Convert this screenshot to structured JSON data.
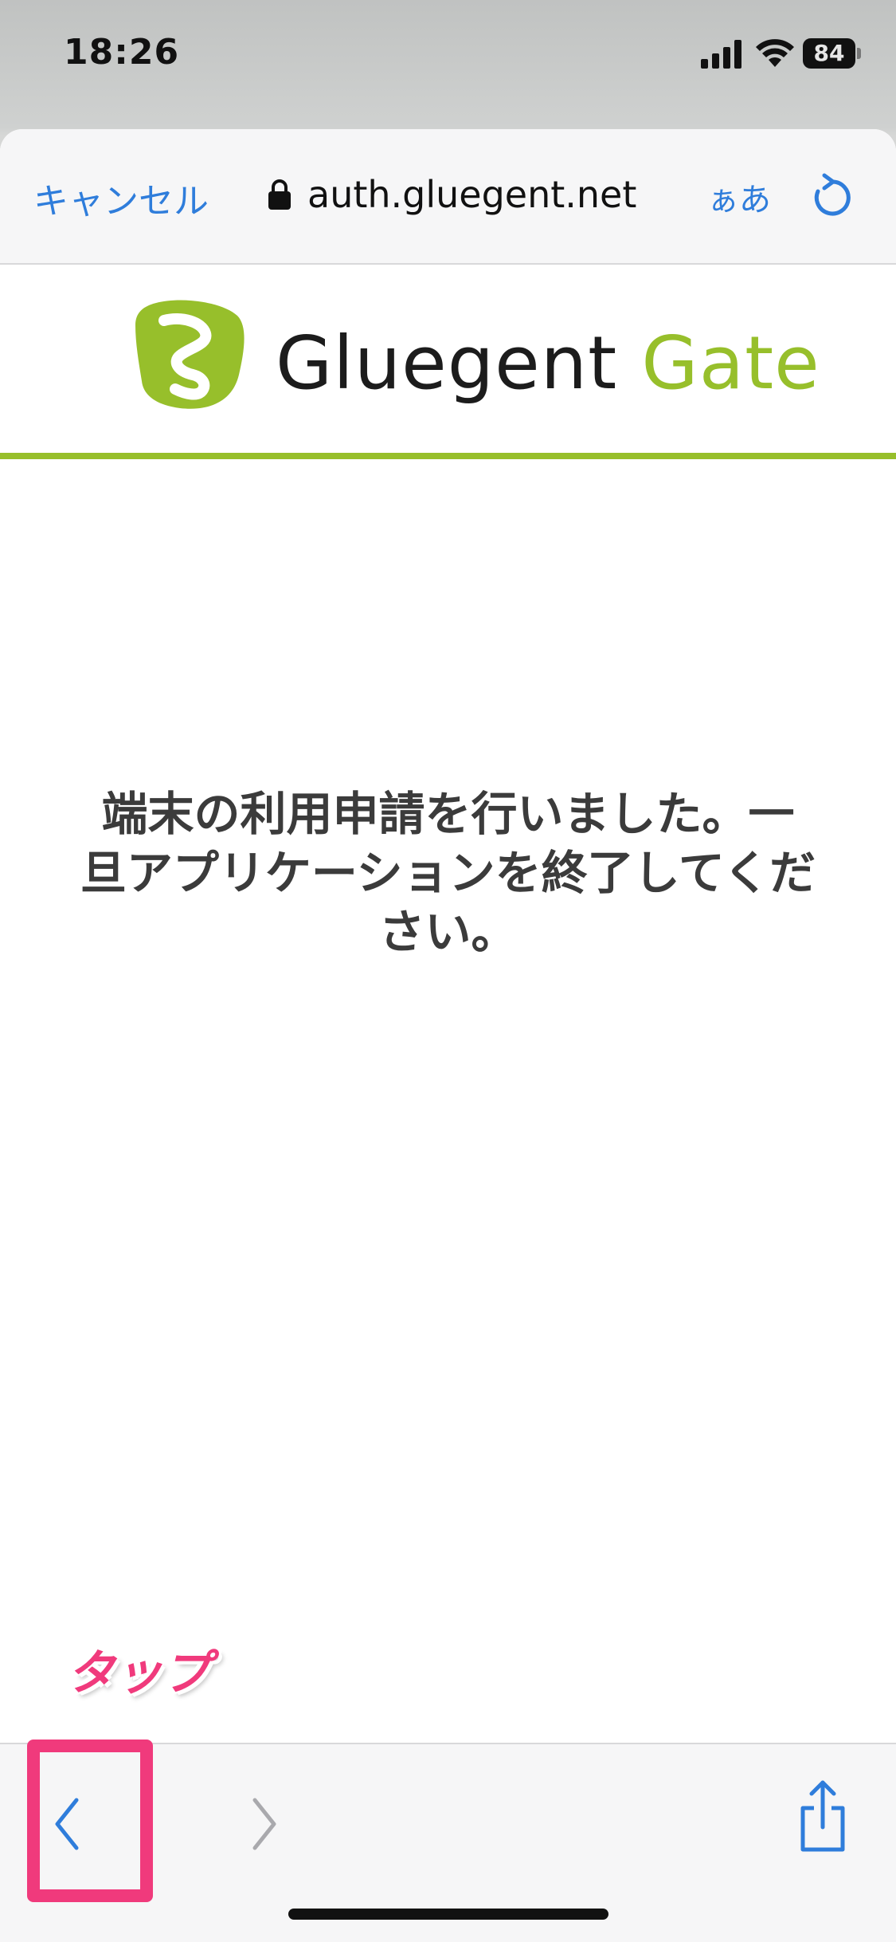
{
  "status_bar": {
    "time": "18:26",
    "battery": "84"
  },
  "nav": {
    "cancel_label": "キャンセル",
    "url": "auth.gluegent.net",
    "text_size_label": "ぁあ"
  },
  "brand": {
    "name_primary": "Gluegent",
    "name_accent": "Gate",
    "accent_color": "#97bf2b"
  },
  "message": "端末の利用申請を行いました。一旦アプリケーションを終了してください。",
  "annotation": {
    "tap_label": "タップ",
    "highlight_color": "#f03a7c"
  },
  "icons": {
    "signal": "signal-icon",
    "wifi": "wifi-icon",
    "lock": "lock-icon",
    "reload": "reload-icon",
    "back": "chevron-left-icon",
    "forward": "chevron-right-icon",
    "share": "share-icon"
  }
}
